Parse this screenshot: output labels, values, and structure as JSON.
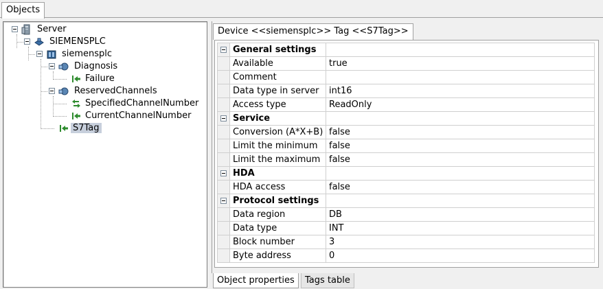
{
  "top_tab": {
    "label": "Objects"
  },
  "tree": {
    "nodes": [
      {
        "label": "Server",
        "icon": "server-icon"
      },
      {
        "label": "SIEMENSPLC",
        "icon": "device-icon"
      },
      {
        "label": "siemensplc",
        "icon": "plc-icon"
      },
      {
        "label": "Diagnosis",
        "icon": "group-icon"
      },
      {
        "label": "Failure",
        "icon": "tag-arrow-icon"
      },
      {
        "label": "ReservedChannels",
        "icon": "group-icon"
      },
      {
        "label": "SpecifiedChannelNumber",
        "icon": "tag-bidirectional-icon"
      },
      {
        "label": "CurrentChannelNumber",
        "icon": "tag-arrow-icon"
      },
      {
        "label": "S7Tag",
        "icon": "tag-arrow-icon",
        "selected": true
      }
    ]
  },
  "device_tab": {
    "label": "Device <<siemensplc>> Tag <<S7Tag>>"
  },
  "properties": {
    "rows": [
      {
        "type": "category",
        "name": "General settings",
        "value": ""
      },
      {
        "type": "prop",
        "name": "Available",
        "value": "true"
      },
      {
        "type": "prop",
        "name": "Comment",
        "value": ""
      },
      {
        "type": "prop",
        "name": "Data type in server",
        "value": "int16"
      },
      {
        "type": "prop",
        "name": "Access type",
        "value": "ReadOnly"
      },
      {
        "type": "category",
        "name": "Service",
        "value": ""
      },
      {
        "type": "prop",
        "name": "Conversion (A*X+B)",
        "value": "false"
      },
      {
        "type": "prop",
        "name": "Limit the minimum",
        "value": "false"
      },
      {
        "type": "prop",
        "name": "Limit the maximum",
        "value": "false"
      },
      {
        "type": "category",
        "name": "HDA",
        "value": ""
      },
      {
        "type": "prop",
        "name": "HDA access",
        "value": "false"
      },
      {
        "type": "category",
        "name": "Protocol settings",
        "value": ""
      },
      {
        "type": "prop",
        "name": "Data region",
        "value": "DB"
      },
      {
        "type": "prop",
        "name": "Data type",
        "value": "INT"
      },
      {
        "type": "prop",
        "name": "Block number",
        "value": "3"
      },
      {
        "type": "prop",
        "name": "Byte address",
        "value": "0"
      }
    ]
  },
  "bottom_tabs": {
    "object_properties": "Object properties",
    "tags_table": "Tags table"
  },
  "colors": {
    "selection": "#c7cfdc",
    "tag_arrow": "#2e8b2e",
    "device_blue": "#3a6ea5"
  }
}
